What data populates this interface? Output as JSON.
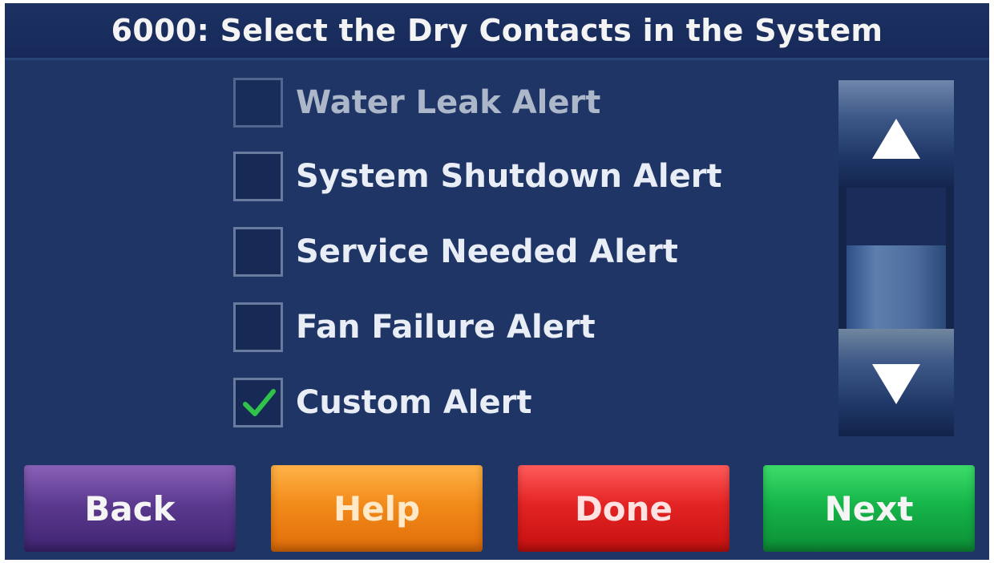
{
  "header": {
    "title": "6000: Select the Dry Contacts in the System"
  },
  "list": {
    "items": [
      {
        "label": "Water Leak Alert",
        "checked": false
      },
      {
        "label": "System Shutdown Alert",
        "checked": false
      },
      {
        "label": "Service Needed Alert",
        "checked": false
      },
      {
        "label": "Fan Failure Alert",
        "checked": false
      },
      {
        "label": "Custom Alert",
        "checked": true
      }
    ]
  },
  "scrollbar": {
    "up_icon": "triangle-up-icon",
    "down_icon": "triangle-down-icon"
  },
  "footer": {
    "back_label": "Back",
    "help_label": "Help",
    "done_label": "Done",
    "next_label": "Next"
  },
  "colors": {
    "background": "#1f3565",
    "checkmark": "#2fc34a",
    "back": "#5b3a8f",
    "help": "#f28b1a",
    "done": "#e42424",
    "next": "#16b54a"
  }
}
